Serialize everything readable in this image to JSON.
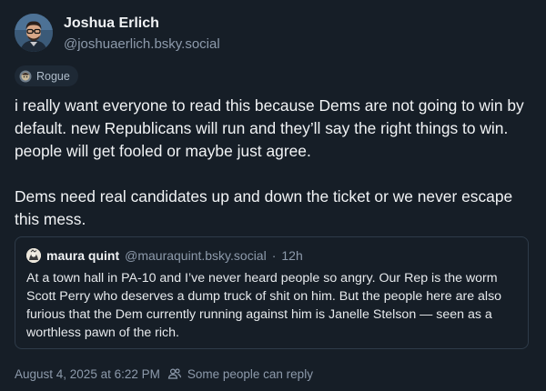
{
  "author": {
    "display_name": "Joshua Erlich",
    "handle": "@joshuaerlich.bsky.social",
    "avatar_icon": "avatar-photo"
  },
  "label": {
    "icon": "rogue-icon",
    "text": "Rogue"
  },
  "post": {
    "text": "i really want everyone to read this because Dems are not going to win by default. new Republicans will run and they’ll say the right things to win. people will get fooled or maybe just agree.\n\nDems need real candidates up and down the ticket or we never escape this mess."
  },
  "quote": {
    "display_name": "maura quint",
    "handle": "@mauraquint.bsky.social",
    "separator": "·",
    "time": "12h",
    "text": "At a town hall in PA-10 and I’ve never heard people so angry. Our Rep is the worm Scott Perry who deserves a dump truck of shit on him. But the people here are also furious that the Dem currently running against him is Janelle Stelson — seen as a worthless pawn of the rich."
  },
  "footer": {
    "timestamp": "August 4, 2025 at 6:22 PM",
    "reply_icon": "people-icon",
    "reply_setting": "Some people can reply"
  },
  "colors": {
    "background": "#161e27",
    "text_primary": "#f1f3f5",
    "text_secondary": "#8d9aab",
    "border": "#2e3b49"
  }
}
